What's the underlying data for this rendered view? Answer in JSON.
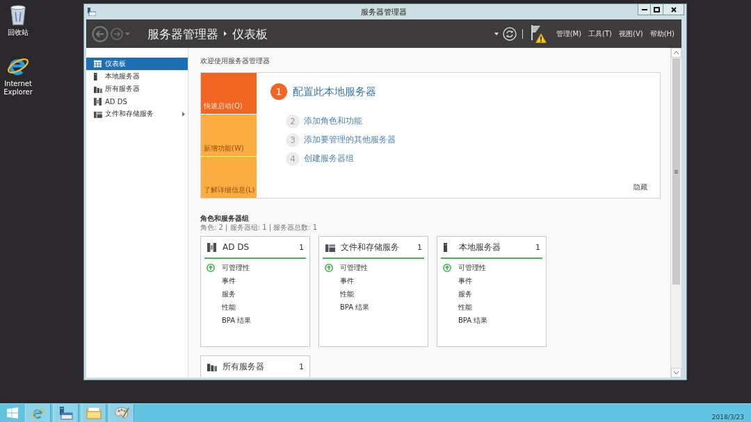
{
  "desktop": {
    "icons": [
      {
        "kind": "recycle_bin",
        "label": "回收站"
      },
      {
        "kind": "browser",
        "label": "Internet Explorer"
      }
    ]
  },
  "window": {
    "title": "服务器管理器"
  },
  "header": {
    "breadcrumb": [
      "服务器管理器",
      "仪表板"
    ],
    "warning": true,
    "menus": [
      "管理(M)",
      "工具(T)",
      "视图(V)",
      "帮助(H)"
    ]
  },
  "sidebar": {
    "items": [
      {
        "kind": "dashboard",
        "label": "仪表板",
        "selected": true,
        "expandable": false
      },
      {
        "kind": "local_server",
        "label": "本地服务器",
        "selected": false,
        "expandable": false
      },
      {
        "kind": "all_servers",
        "label": "所有服务器",
        "selected": false,
        "expandable": false
      },
      {
        "kind": "ad_ds",
        "label": "AD DS",
        "selected": false,
        "expandable": false
      },
      {
        "kind": "file_storage",
        "label": "文件和存储服务",
        "selected": false,
        "expandable": true
      }
    ]
  },
  "welcome": {
    "heading": "欢迎使用服务器管理器",
    "tabs": [
      {
        "label": "快速启动(Q)",
        "selected": true
      },
      {
        "label": "新增功能(W)",
        "selected": false
      },
      {
        "label": "了解详细信息(L)",
        "selected": false
      }
    ],
    "steps": [
      {
        "number": "1",
        "label": "配置此本地服务器",
        "current": true
      },
      {
        "number": "2",
        "label": "添加角色和功能",
        "current": false
      },
      {
        "number": "3",
        "label": "添加要管理的其他服务器",
        "current": false
      },
      {
        "number": "4",
        "label": "创建服务器组",
        "current": false
      }
    ],
    "hide": "隐藏"
  },
  "roles": {
    "title": "角色和服务器组",
    "summary": "角色: 2 | 服务器组: 1 | 服务器总数: 1",
    "tiles": [
      {
        "kind": "ad_ds",
        "title": "AD DS",
        "count": "1",
        "rows": [
          {
            "label": "可管理性",
            "ok": true
          },
          {
            "label": "事件",
            "ok": false
          },
          {
            "label": "服务",
            "ok": false
          },
          {
            "label": "性能",
            "ok": false
          },
          {
            "label": "BPA 结果",
            "ok": false
          }
        ]
      },
      {
        "kind": "file_storage",
        "title": "文件和存储服务",
        "count": "1",
        "rows": [
          {
            "label": "可管理性",
            "ok": true
          },
          {
            "label": "事件",
            "ok": false
          },
          {
            "label": "性能",
            "ok": false
          },
          {
            "label": "BPA 结果",
            "ok": false
          }
        ]
      },
      {
        "kind": "local_server",
        "title": "本地服务器",
        "count": "1",
        "rows": [
          {
            "label": "可管理性",
            "ok": true
          },
          {
            "label": "事件",
            "ok": false
          },
          {
            "label": "服务",
            "ok": false
          },
          {
            "label": "性能",
            "ok": false
          },
          {
            "label": "BPA 结果",
            "ok": false
          }
        ]
      },
      {
        "kind": "all_servers",
        "title": "所有服务器",
        "count": "1"
      }
    ]
  },
  "taskbar": {
    "apps": [
      {
        "kind": "browser"
      },
      {
        "kind": "server_manager"
      },
      {
        "kind": "file_explorer"
      },
      {
        "kind": "paint"
      }
    ],
    "date": "2018/3/23"
  }
}
